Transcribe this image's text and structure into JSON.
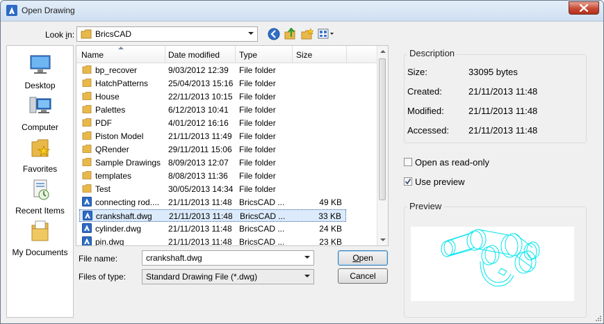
{
  "window": {
    "title": "Open Drawing"
  },
  "lookin": {
    "label_prefix": "Look ",
    "label_underlined": "i",
    "label_suffix": "n:",
    "value": "BricsCAD"
  },
  "toolbar": [
    "back-icon",
    "up-folder-icon",
    "new-folder-icon",
    "views-menu-icon"
  ],
  "places": [
    {
      "label": "Desktop",
      "icon": "desktop-icon"
    },
    {
      "label": "Computer",
      "icon": "computer-icon"
    },
    {
      "label": "Favorites",
      "icon": "favorites-icon"
    },
    {
      "label": "Recent Items",
      "icon": "recent-items-icon"
    },
    {
      "label": "My Documents",
      "icon": "my-documents-icon"
    }
  ],
  "columns": [
    "Name",
    "Date modified",
    "Type",
    "Size"
  ],
  "files": [
    {
      "name": "bp_recover",
      "date": "9/03/2012 12:39",
      "type": "File folder",
      "size": "",
      "kind": "folder"
    },
    {
      "name": "HatchPatterns",
      "date": "25/04/2013 15:16",
      "type": "File folder",
      "size": "",
      "kind": "folder"
    },
    {
      "name": "House",
      "date": "22/11/2013 10:15",
      "type": "File folder",
      "size": "",
      "kind": "folder"
    },
    {
      "name": "Palettes",
      "date": "6/12/2013 10:41",
      "type": "File folder",
      "size": "",
      "kind": "folder"
    },
    {
      "name": "PDF",
      "date": "4/01/2012 16:16",
      "type": "File folder",
      "size": "",
      "kind": "folder"
    },
    {
      "name": "Piston Model",
      "date": "21/11/2013 11:49",
      "type": "File folder",
      "size": "",
      "kind": "folder"
    },
    {
      "name": "QRender",
      "date": "29/11/2011 15:06",
      "type": "File folder",
      "size": "",
      "kind": "folder"
    },
    {
      "name": "Sample Drawings",
      "date": "8/09/2013 12:07",
      "type": "File folder",
      "size": "",
      "kind": "folder"
    },
    {
      "name": "templates",
      "date": "8/08/2013 11:36",
      "type": "File folder",
      "size": "",
      "kind": "folder"
    },
    {
      "name": "Test",
      "date": "30/05/2013 14:34",
      "type": "File folder",
      "size": "",
      "kind": "folder"
    },
    {
      "name": "connecting rod....",
      "date": "21/11/2013 11:48",
      "type": "BricsCAD ...",
      "size": "49 KB",
      "kind": "dwg"
    },
    {
      "name": "crankshaft.dwg",
      "date": "21/11/2013 11:48",
      "type": "BricsCAD ...",
      "size": "33 KB",
      "kind": "dwg",
      "selected": true
    },
    {
      "name": "cylinder.dwg",
      "date": "21/11/2013 11:48",
      "type": "BricsCAD ...",
      "size": "24 KB",
      "kind": "dwg"
    },
    {
      "name": "pin.dwg",
      "date": "21/11/2013 11:48",
      "type": "BricsCAD ...",
      "size": "23 KB",
      "kind": "dwg"
    }
  ],
  "filename": {
    "label": "File name:",
    "value": "crankshaft.dwg"
  },
  "filetype": {
    "label": "Files of type:",
    "value": "Standard Drawing File (*.dwg)"
  },
  "buttons": {
    "open_underlined": "O",
    "open_rest": "pen",
    "cancel": "Cancel"
  },
  "description": {
    "title": "Description",
    "rows": [
      {
        "label": "Size:",
        "value": "33095 bytes"
      },
      {
        "label": "Created:",
        "value": "21/11/2013 11:48"
      },
      {
        "label": "Modified:",
        "value": "21/11/2013 11:48"
      },
      {
        "label": "Accessed:",
        "value": "21/11/2013 11:48"
      }
    ]
  },
  "options": [
    {
      "label": "Open as read-only",
      "checked": false
    },
    {
      "label": "Use preview",
      "checked": true
    }
  ],
  "preview": {
    "title": "Preview",
    "line_color": "#00e5ee"
  },
  "colors": {
    "selection_bg": "#dcebfc",
    "folder": "#e8b94a",
    "close": "#c74a36"
  }
}
